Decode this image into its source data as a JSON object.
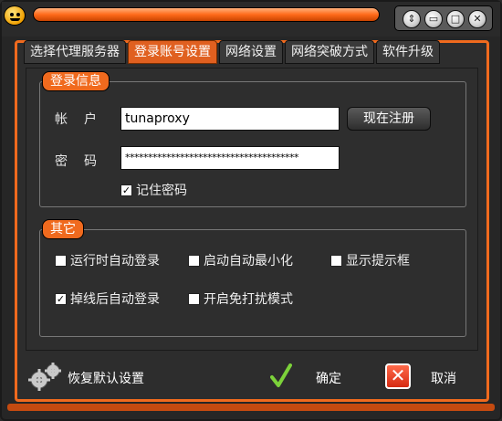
{
  "tabs": [
    {
      "label": "选择代理服务器"
    },
    {
      "label": "登录账号设置"
    },
    {
      "label": "网络设置"
    },
    {
      "label": "网络突破方式"
    },
    {
      "label": "软件升级"
    }
  ],
  "login_group": {
    "title": "登录信息",
    "account_label": "帐户",
    "account_value": "tunaproxy",
    "register_button": "现在注册",
    "password_label": "密码",
    "password_value": "**************************************",
    "remember_label": "记住密码",
    "remember_checked": true
  },
  "other_group": {
    "title": "其它",
    "options": [
      {
        "label": "运行时自动登录",
        "checked": false
      },
      {
        "label": "启动自动最小化",
        "checked": false
      },
      {
        "label": "显示提示框",
        "checked": false
      },
      {
        "label": "掉线后自动登录",
        "checked": true
      },
      {
        "label": "开启免打扰模式",
        "checked": false
      }
    ]
  },
  "actions": {
    "restore_defaults": "恢复默认设置",
    "ok": "确定",
    "cancel": "取消"
  },
  "window_controls": {
    "updown": "⇕",
    "minimize": "▭",
    "maximize": "□",
    "close": "✕"
  },
  "colors": {
    "accent": "#f06a1e",
    "background": "#2d2d2d"
  }
}
